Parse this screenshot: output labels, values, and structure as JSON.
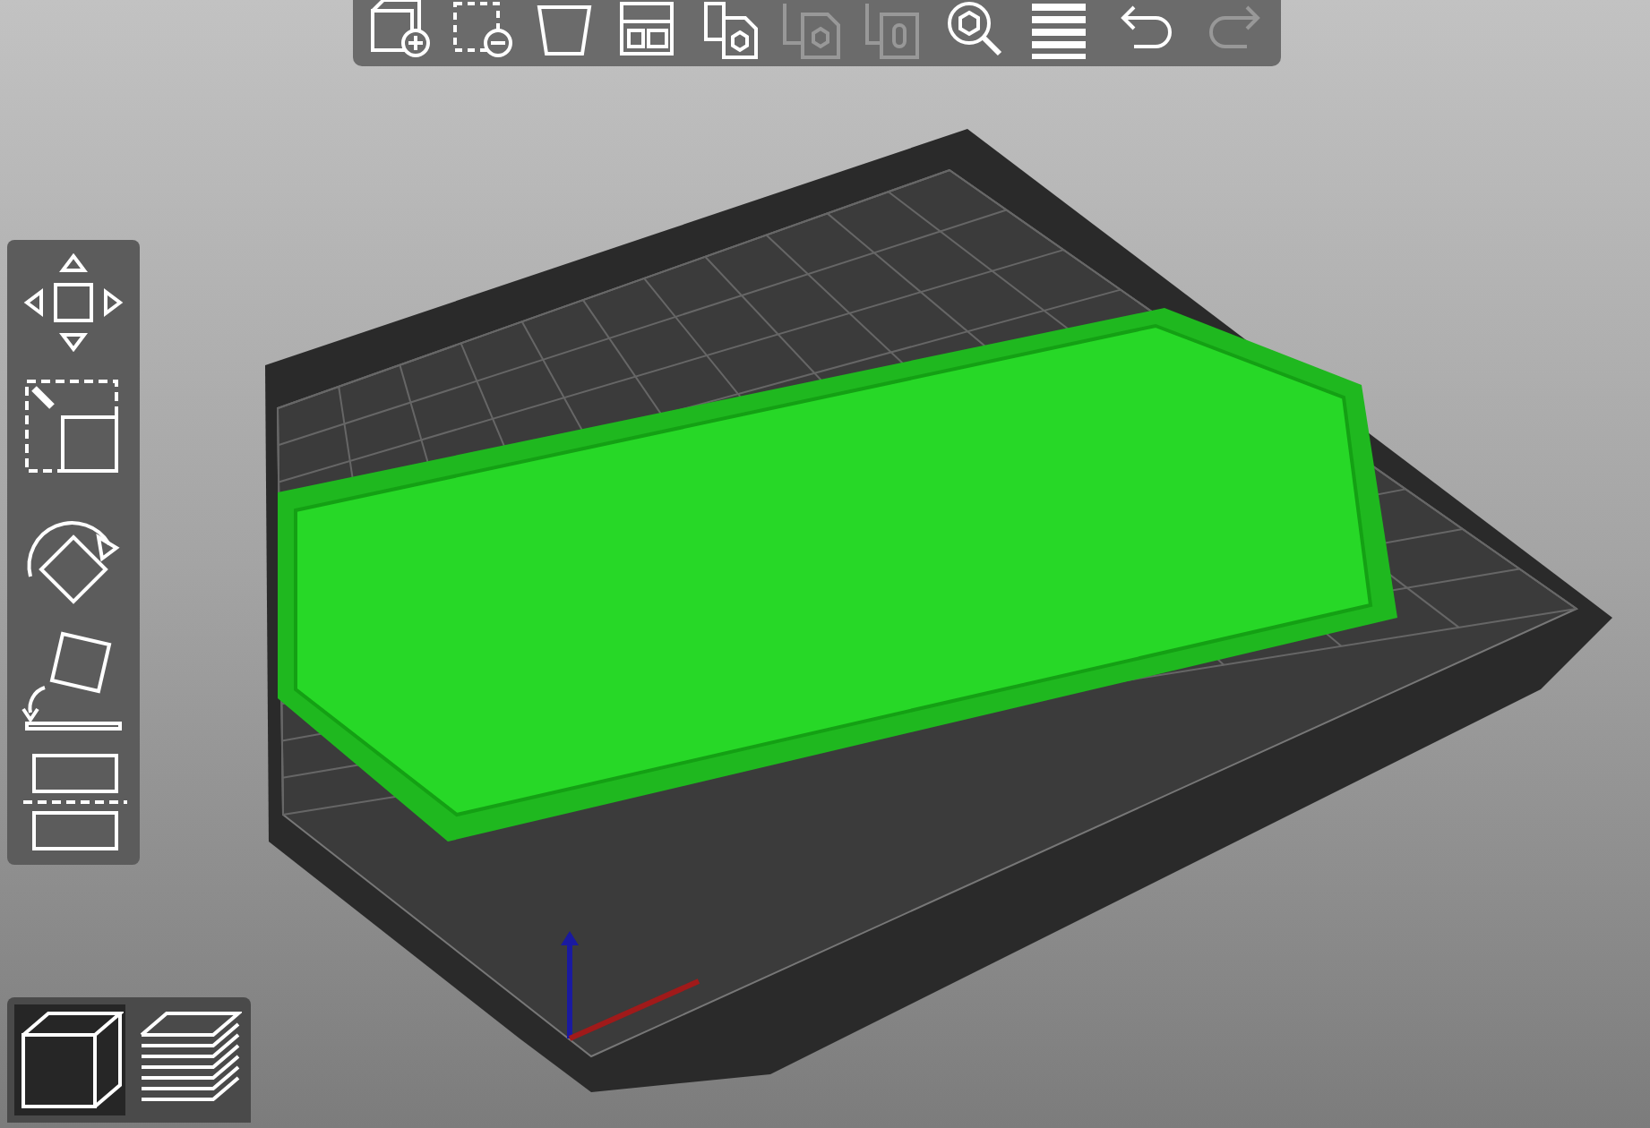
{
  "top_toolbar": [
    {
      "kind": "add",
      "disabled": false
    },
    {
      "kind": "delete",
      "disabled": false
    },
    {
      "kind": "delete_all",
      "disabled": false
    },
    {
      "kind": "arrange",
      "disabled": false
    },
    {
      "kind": "copy",
      "disabled": false
    },
    {
      "kind": "paste",
      "disabled": true
    },
    {
      "kind": "instances",
      "disabled": true
    },
    {
      "kind": "search",
      "disabled": false
    },
    {
      "kind": "layers",
      "disabled": false
    },
    {
      "kind": "undo",
      "disabled": false
    },
    {
      "kind": "redo",
      "disabled": true
    }
  ],
  "gizmos": [
    {
      "kind": "move"
    },
    {
      "kind": "scale"
    },
    {
      "kind": "rotate"
    },
    {
      "kind": "place"
    },
    {
      "kind": "cut"
    }
  ],
  "views": [
    {
      "kind": "model",
      "selected": true
    },
    {
      "kind": "preview",
      "selected": false
    }
  ]
}
